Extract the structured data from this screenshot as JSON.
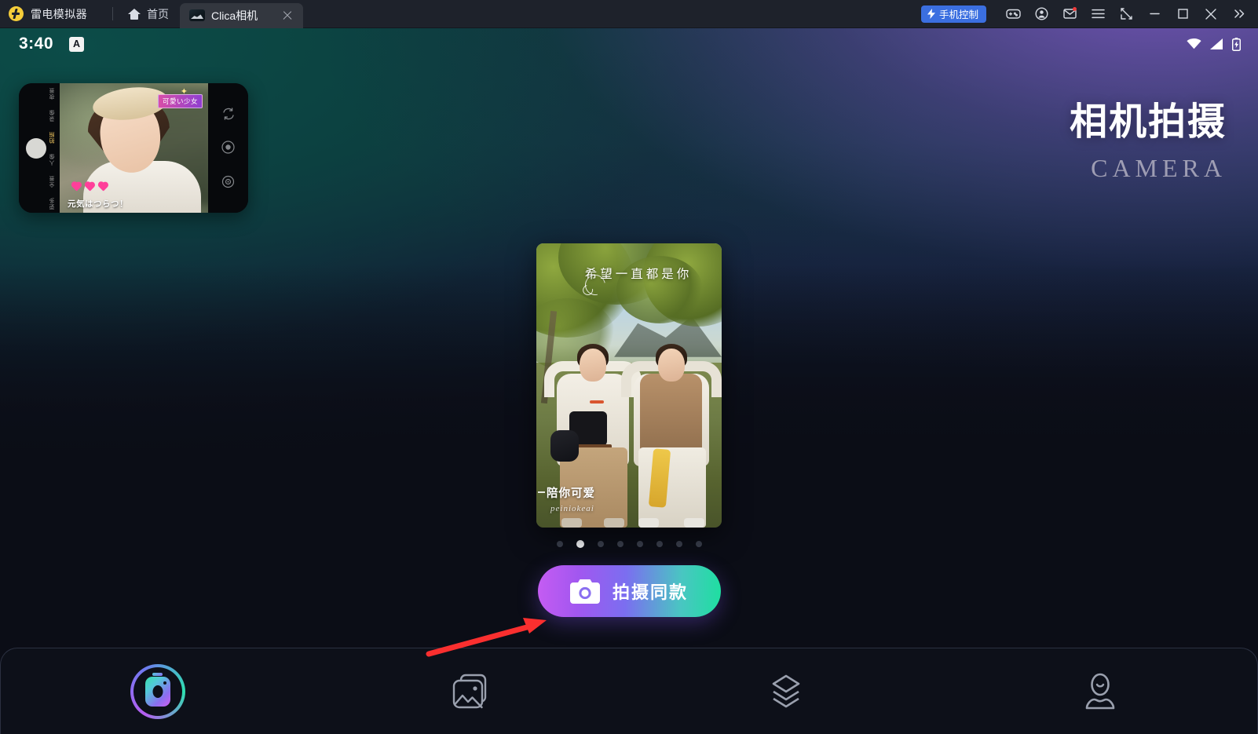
{
  "titlebar": {
    "brand": "雷电模拟器",
    "logo_icon": "ldplayer-logo-icon",
    "tabs": [
      {
        "label": "首页",
        "icon": "home-icon",
        "active": false
      },
      {
        "label": "Clica相机",
        "icon": "app-thumbnail-icon",
        "active": true,
        "close_icon": "close-icon"
      }
    ],
    "phone_control": {
      "label": "手机控制",
      "icon": "bolt-icon",
      "color": "#3b6fe0"
    },
    "icons": [
      {
        "name": "gamepad-icon"
      },
      {
        "name": "account-icon"
      },
      {
        "name": "mail-icon",
        "badge": true
      },
      {
        "name": "menu-icon"
      },
      {
        "name": "resize-icon"
      },
      {
        "name": "minimize-icon"
      },
      {
        "name": "maximize-icon"
      },
      {
        "name": "close-window-icon"
      },
      {
        "name": "expand-more-icon"
      }
    ]
  },
  "statusbar": {
    "clock": "3:40",
    "badge": "A",
    "icons": [
      "wifi-icon",
      "signal-icon",
      "battery-charging-icon"
    ]
  },
  "preview": {
    "modes": [
      "夜景",
      "录像",
      "拍照",
      "人像",
      "全景",
      "更多"
    ],
    "active_mode": "拍照",
    "sticker_tag": "可愛い少女",
    "caption": "元気はつらつ！",
    "right_icons": [
      "flip-camera-icon",
      "capture-icon",
      "settings-icon"
    ]
  },
  "hero": {
    "title_cn": "相机拍摄",
    "title_en": "CAMERA"
  },
  "photo_card": {
    "overlay_title": "希望一直都是你",
    "brand": "陪你可爱",
    "brand_sub": "peiniokeai",
    "decor_icon": "swirl-icon"
  },
  "carousel": {
    "total": 8,
    "active_index": 1
  },
  "cta": {
    "label": "拍摄同款",
    "icon": "camera-icon",
    "gradient_from": "#c55cf2",
    "gradient_to": "#1edfa0"
  },
  "annotation": {
    "arrow_color": "#fa2f2f"
  },
  "bottom_nav": {
    "items": [
      {
        "name": "camera",
        "icon": "camera-nav-icon",
        "active": true
      },
      {
        "name": "gallery",
        "icon": "gallery-icon",
        "active": false
      },
      {
        "name": "templates",
        "icon": "layers-icon",
        "active": false
      },
      {
        "name": "profile",
        "icon": "person-icon",
        "active": false
      }
    ]
  }
}
